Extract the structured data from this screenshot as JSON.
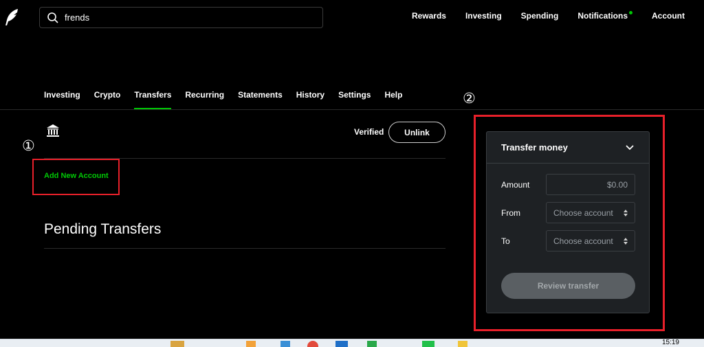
{
  "search": {
    "value": "frends"
  },
  "topnav": {
    "rewards": "Rewards",
    "investing": "Investing",
    "spending": "Spending",
    "notifications": "Notifications",
    "account": "Account"
  },
  "tabs": [
    "Investing",
    "Crypto",
    "Transfers",
    "Recurring",
    "Statements",
    "History",
    "Settings",
    "Help"
  ],
  "active_tab": "Transfers",
  "bank": {
    "status": "Verified",
    "unlink_label": "Unlink"
  },
  "add_account_label": "Add New Account",
  "pending_title": "Pending Transfers",
  "annotations": {
    "marker1": "①",
    "marker2": "②"
  },
  "transfer": {
    "title": "Transfer money",
    "amount_label": "Amount",
    "amount_value": "$0.00",
    "from_label": "From",
    "from_placeholder": "Choose account",
    "to_label": "To",
    "to_placeholder": "Choose account",
    "review_label": "Review transfer"
  },
  "taskbar": {
    "time": "15:19"
  },
  "colors": {
    "accent": "#00c805",
    "annotation": "#e8202a",
    "card_bg": "#1e2124"
  }
}
